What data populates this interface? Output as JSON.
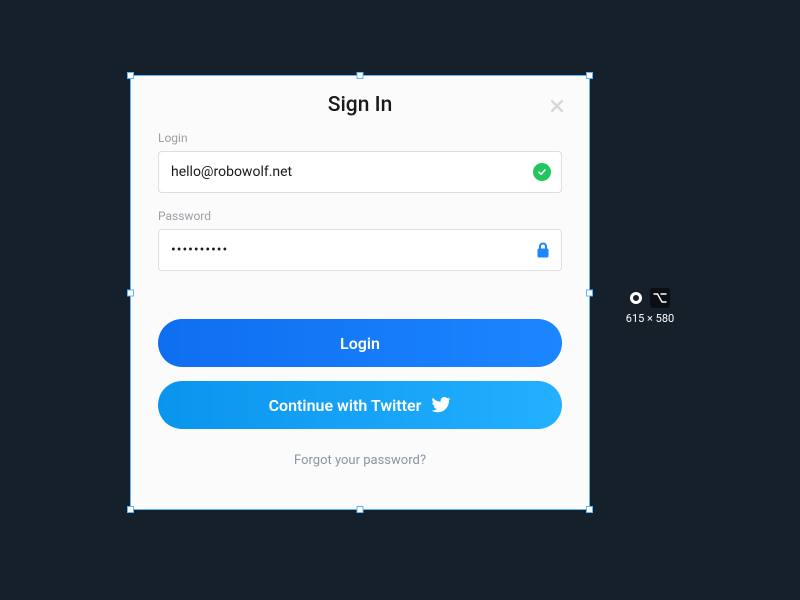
{
  "modal": {
    "title": "Sign In",
    "login": {
      "label": "Login",
      "value": "hello@robowolf.net"
    },
    "password": {
      "label": "Password",
      "value": "••••••••••"
    },
    "actions": {
      "login_label": "Login",
      "twitter_label": "Continue with Twitter"
    },
    "forgot_label": "Forgot your password?"
  },
  "editor": {
    "dimensions": "615 × 580"
  },
  "colors": {
    "canvas_bg": "#15202b",
    "primary_start": "#0e6ef0",
    "primary_end": "#1b86ff",
    "twitter_start": "#0a95ed",
    "twitter_end": "#22b0ff",
    "success": "#22c55e",
    "lock_icon": "#1b86ff"
  }
}
